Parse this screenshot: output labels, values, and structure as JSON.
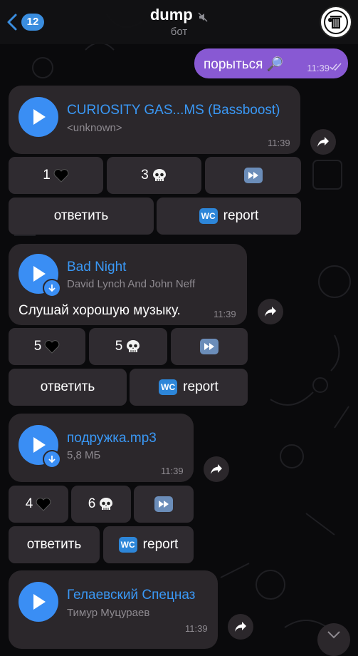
{
  "header": {
    "back_count": "12",
    "title": "dump",
    "subtitle": "бот"
  },
  "outgoing": {
    "text": "порыться 🔎",
    "time": "11:39"
  },
  "messages": [
    {
      "title": "CURIOSITY GAS...MS (Bassboost)",
      "subtitle": "<unknown>",
      "time": "11:39",
      "likes": "1",
      "skulls": "3",
      "reply_label": "ответить",
      "report_label": "report",
      "wc_label": "WC"
    },
    {
      "title": "Bad Night",
      "subtitle": "David Lynch And John Neff",
      "caption": "Слушай хорошую музыку.",
      "time": "11:39",
      "likes": "5",
      "skulls": "5",
      "reply_label": "ответить",
      "report_label": "report",
      "wc_label": "WC"
    },
    {
      "title": "подружка.mp3",
      "subtitle": "5,8 МБ",
      "time": "11:39",
      "likes": "4",
      "skulls": "6",
      "reply_label": "ответить",
      "report_label": "report",
      "wc_label": "WC"
    },
    {
      "title": "Гелаевский Спецназ",
      "subtitle": "Тимур Муцураев",
      "time": "11:39"
    }
  ],
  "colors": {
    "accent": "#3a8ef4",
    "outgoing_bubble": "#8859d3",
    "incoming_bubble": "#2b272b"
  }
}
